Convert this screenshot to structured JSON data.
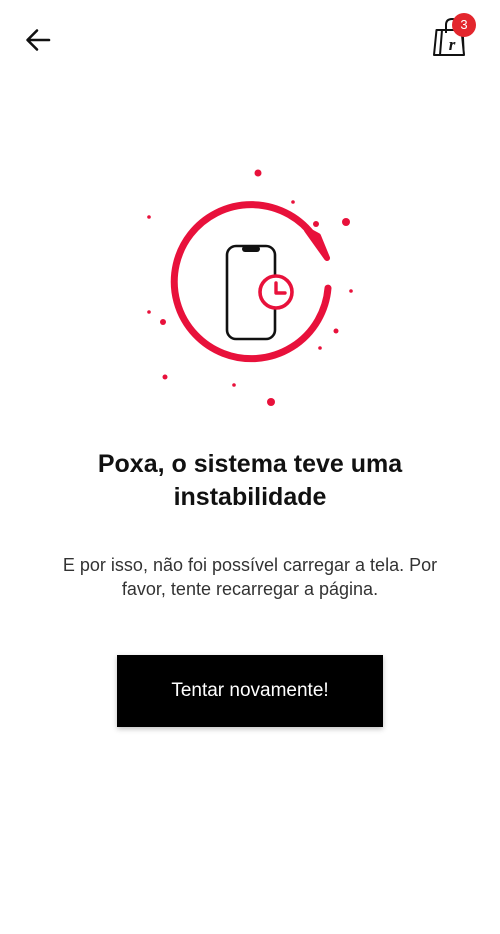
{
  "header": {
    "back_icon": "arrow-left-icon",
    "cart_icon": "shopping-bag-icon",
    "cart_count": "3"
  },
  "illustration": {
    "icon": "phone-reload-icon"
  },
  "error": {
    "title": "Poxa, o sistema teve uma instabilidade",
    "message": "E por isso, não foi possível carregar a tela. Por favor, tente recarregar a página.",
    "retry_label": "Tentar novamente!"
  },
  "colors": {
    "accent": "#e8113b",
    "button_bg": "#000000",
    "badge_bg": "#e3262d"
  }
}
